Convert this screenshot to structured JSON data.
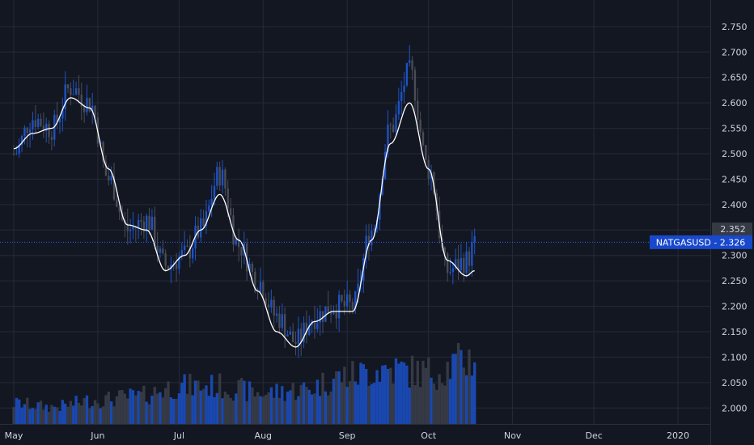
{
  "chart_data": {
    "type": "candlestick",
    "title": "",
    "symbol": "NATGASUSD",
    "last_price": "2.326",
    "highlight_price": "2.352",
    "y_ticks": [
      "2.750",
      "2.700",
      "2.650",
      "2.600",
      "2.550",
      "2.500",
      "2.450",
      "2.400",
      "2.350",
      "2.300",
      "2.250",
      "2.200",
      "2.150",
      "2.100",
      "2.050",
      "2.000"
    ],
    "y_range": [
      1.975,
      2.78
    ],
    "x_ticks": [
      "May",
      "Jun",
      "Jul",
      "Aug",
      "Sep",
      "Oct",
      "Nov",
      "Dec",
      "2020"
    ],
    "grid": true,
    "colors": {
      "background": "#131722",
      "grid": "#252a36",
      "up": "#1e53c4",
      "down": "#4a4d57",
      "moving_average": "#ffffff",
      "badge": "#2962ff",
      "level_badge": "#363a45",
      "text": "#d1d4dc"
    },
    "price_anchors": {
      "dates": [
        "2019-05-01",
        "2019-05-08",
        "2019-05-15",
        "2019-05-22",
        "2019-05-29",
        "2019-06-05",
        "2019-06-12",
        "2019-06-19",
        "2019-06-26",
        "2019-07-03",
        "2019-07-09",
        "2019-07-16",
        "2019-07-23",
        "2019-07-30",
        "2019-08-06",
        "2019-08-13",
        "2019-08-20",
        "2019-08-27",
        "2019-09-03",
        "2019-09-10",
        "2019-09-17",
        "2019-09-24",
        "2019-10-01",
        "2019-10-08",
        "2019-10-15",
        "2019-10-18"
      ],
      "close": [
        2.5,
        2.57,
        2.55,
        2.63,
        2.6,
        2.45,
        2.35,
        2.37,
        2.28,
        2.3,
        2.35,
        2.46,
        2.32,
        2.25,
        2.18,
        2.13,
        2.18,
        2.2,
        2.2,
        2.35,
        2.55,
        2.66,
        2.47,
        2.27,
        2.29,
        2.32
      ]
    },
    "moving_average_anchors": {
      "dates": [
        "2019-05-01",
        "2019-05-08",
        "2019-05-15",
        "2019-05-22",
        "2019-05-29",
        "2019-06-05",
        "2019-06-12",
        "2019-06-19",
        "2019-06-26",
        "2019-07-03",
        "2019-07-09",
        "2019-07-16",
        "2019-07-23",
        "2019-07-30",
        "2019-08-06",
        "2019-08-13",
        "2019-08-20",
        "2019-08-27",
        "2019-09-03",
        "2019-09-10",
        "2019-09-17",
        "2019-09-24",
        "2019-10-01",
        "2019-10-08",
        "2019-10-15",
        "2019-10-18"
      ],
      "values": [
        2.51,
        2.54,
        2.55,
        2.61,
        2.59,
        2.47,
        2.36,
        2.35,
        2.27,
        2.3,
        2.35,
        2.42,
        2.33,
        2.23,
        2.15,
        2.12,
        2.17,
        2.19,
        2.19,
        2.33,
        2.52,
        2.6,
        2.47,
        2.29,
        2.26,
        2.27
      ]
    },
    "volume_anchors": {
      "dates": [
        "2019-05-01",
        "2019-05-15",
        "2019-06-01",
        "2019-06-15",
        "2019-07-01",
        "2019-07-15",
        "2019-08-01",
        "2019-08-15",
        "2019-09-01",
        "2019-09-15",
        "2019-10-01",
        "2019-10-18"
      ],
      "volume": [
        0.3,
        0.25,
        0.35,
        0.4,
        0.55,
        0.55,
        0.45,
        0.5,
        0.7,
        0.8,
        0.75,
        0.95
      ]
    }
  }
}
